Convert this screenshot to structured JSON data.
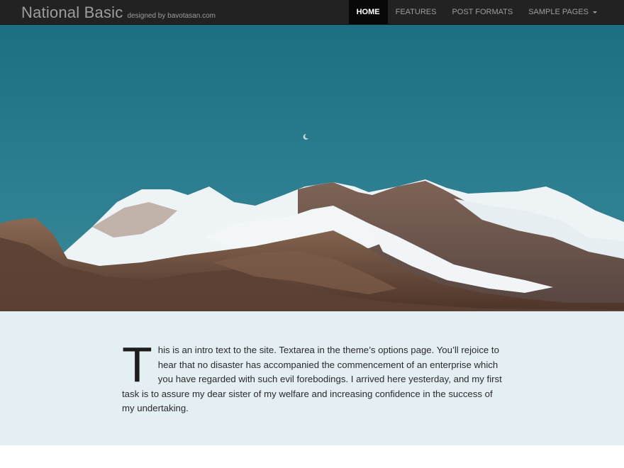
{
  "site": {
    "title": "National Basic",
    "tagline": "designed by bavotasan.com"
  },
  "nav": {
    "items": [
      {
        "label": "HOME",
        "active": true
      },
      {
        "label": "FEATURES"
      },
      {
        "label": "POST FORMATS"
      },
      {
        "label": "SAMPLE PAGES",
        "has_dropdown": true
      }
    ]
  },
  "hero": {
    "sky_color": "#2c7b8c"
  },
  "intro": {
    "dropcap": "T",
    "text": "his is an intro text to the site. Textarea in the theme’s options page. You’ll rejoice to hear that no disaster has accompanied the commencement of an enterprise which you have regarded with such evil forebodings. I arrived here yesterday, and my first task is to assure my dear sister of my welfare and increasing confidence in the success of my undertaking."
  },
  "colors": {
    "navbar_bg": "#222222",
    "nav_active_bg": "#080808",
    "intro_bg": "#e3eff3"
  }
}
